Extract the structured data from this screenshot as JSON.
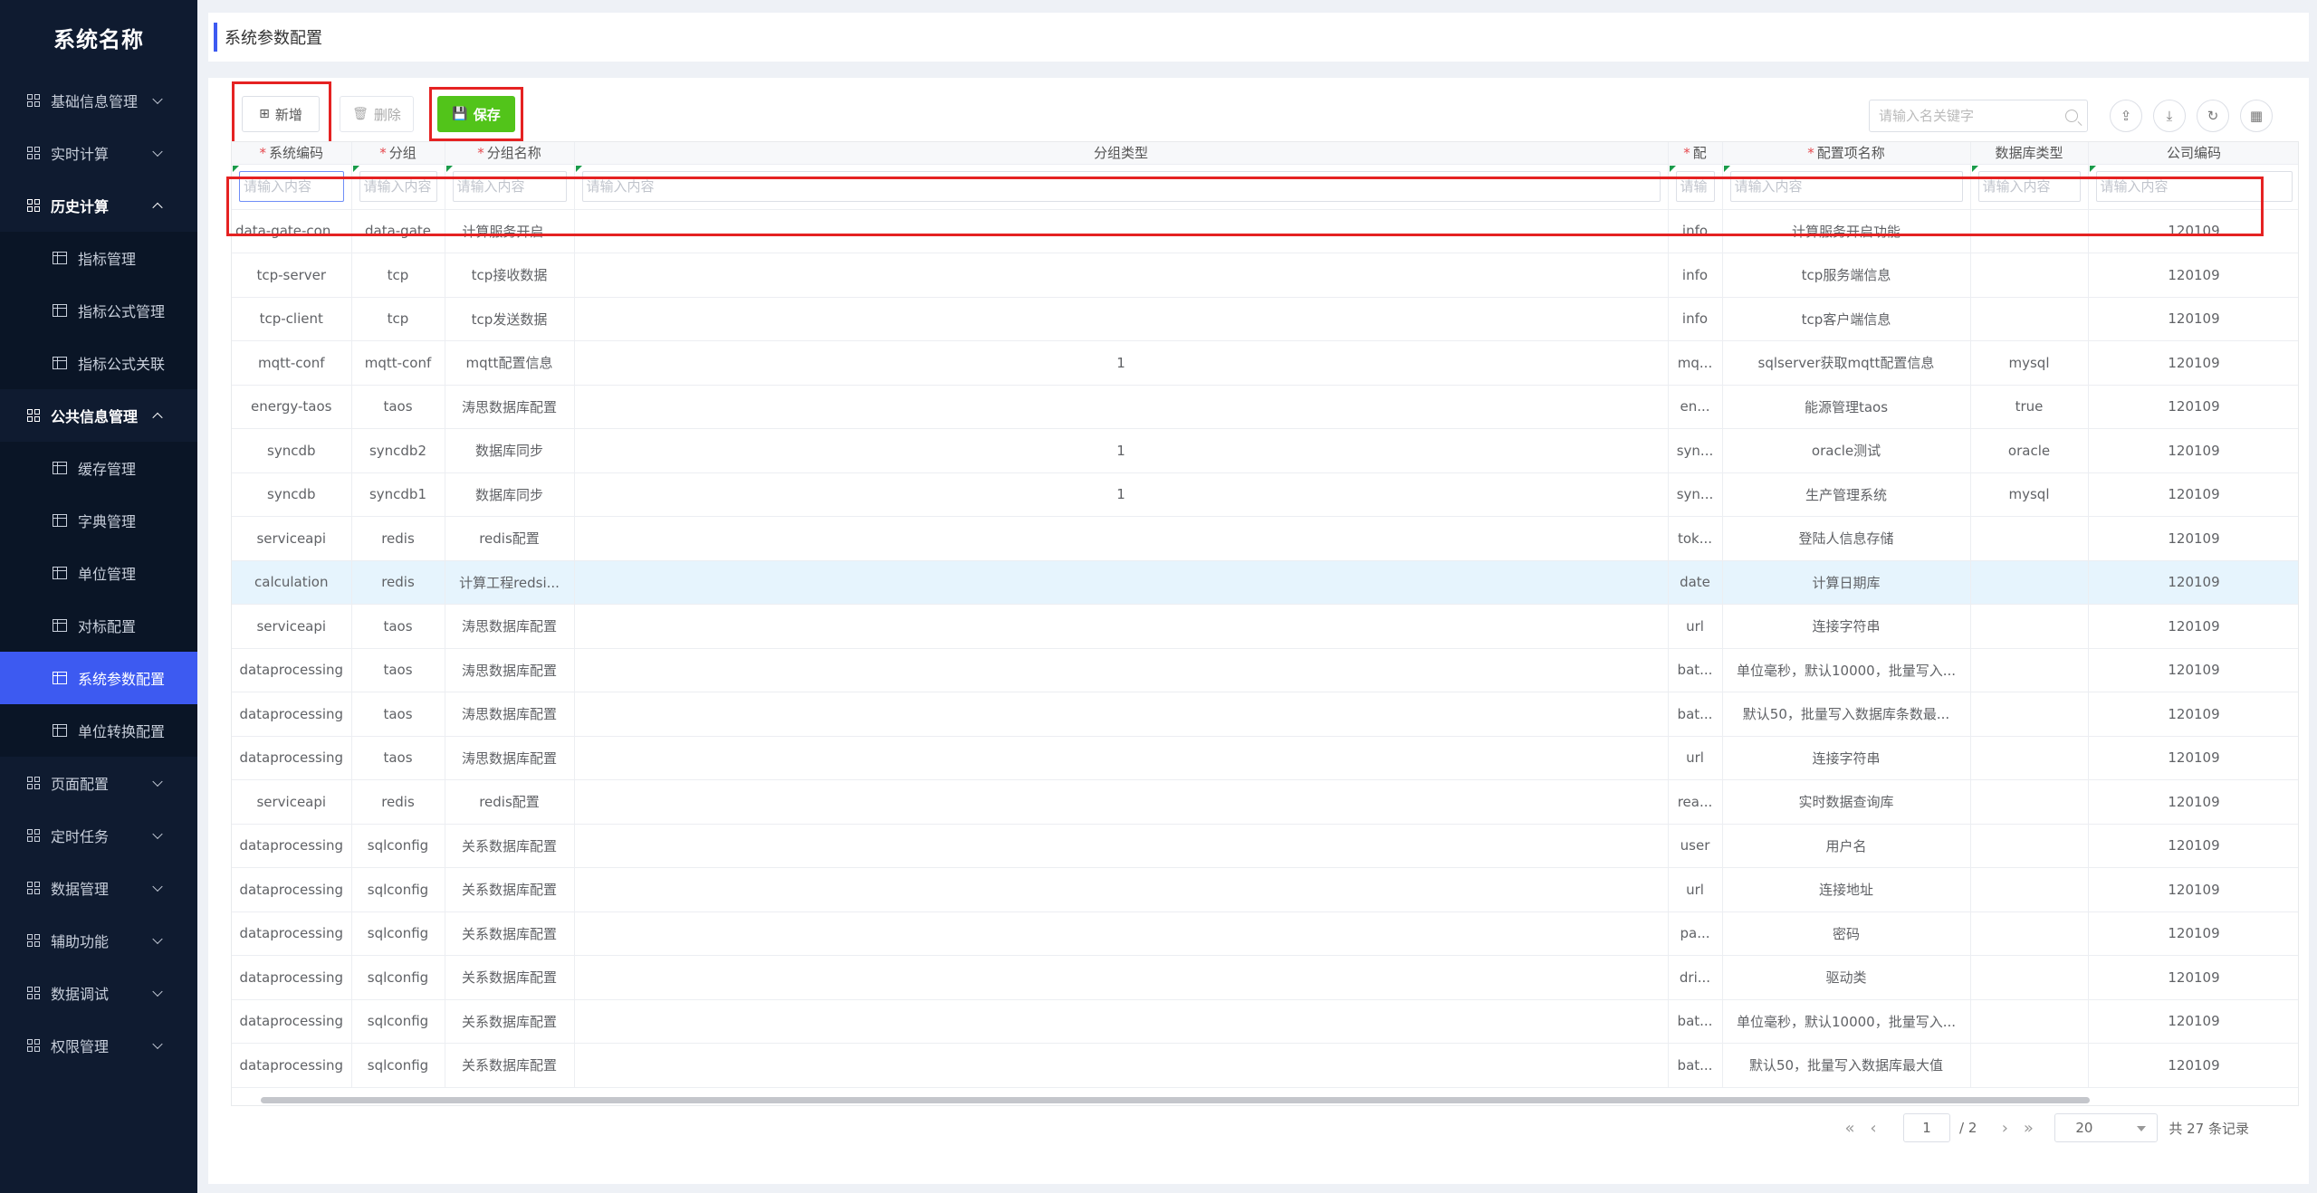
{
  "brand": "系统名称",
  "sidebar": {
    "items": [
      {
        "label": "基础信息管理"
      },
      {
        "label": "实时计算"
      },
      {
        "label": "历史计算",
        "children": [
          "指标管理",
          "指标公式管理",
          "指标公式关联"
        ]
      },
      {
        "label": "公共信息管理",
        "children": [
          "缓存管理",
          "字典管理",
          "单位管理",
          "对标配置",
          "系统参数配置",
          "单位转换配置"
        ]
      },
      {
        "label": "页面配置"
      },
      {
        "label": "定时任务"
      },
      {
        "label": "数据管理"
      },
      {
        "label": "辅助功能"
      },
      {
        "label": "数据调试"
      },
      {
        "label": "权限管理"
      }
    ],
    "active": "系统参数配置"
  },
  "page": {
    "title": "系统参数配置"
  },
  "toolbar": {
    "add_label": "新增",
    "delete_label": "删除",
    "save_label": "保存",
    "search_placeholder": "请输入名关键字"
  },
  "table": {
    "columns": [
      "系统编码",
      "分组",
      "分组名称",
      "分组类型",
      "配",
      "配置项名称",
      "数据库类型",
      "公司编码"
    ],
    "required": [
      true,
      true,
      true,
      false,
      true,
      true,
      false,
      false
    ],
    "filter_placeholder": "请输入内容",
    "filter_placeholder_short": "请输",
    "rows": [
      [
        "data-gate-config",
        "data-gate",
        "计算服务开启...",
        "",
        "info",
        "计算服务开启功能",
        "",
        "120109"
      ],
      [
        "tcp-server",
        "tcp",
        "tcp接收数据",
        "",
        "info",
        "tcp服务端信息",
        "",
        "120109"
      ],
      [
        "tcp-client",
        "tcp",
        "tcp发送数据",
        "",
        "info",
        "tcp客户端信息",
        "",
        "120109"
      ],
      [
        "mqtt-conf",
        "mqtt-conf",
        "mqtt配置信息",
        "1",
        "mq...",
        "sqlserver获取mqtt配置信息",
        "mysql",
        "120109"
      ],
      [
        "energy-taos",
        "taos",
        "涛思数据库配置",
        "",
        "en...",
        "能源管理taos",
        "true",
        "120109"
      ],
      [
        "syncdb",
        "syncdb2",
        "数据库同步",
        "1",
        "syn...",
        "oracle测试",
        "oracle",
        "120109"
      ],
      [
        "syncdb",
        "syncdb1",
        "数据库同步",
        "1",
        "syn...",
        "生产管理系统",
        "mysql",
        "120109"
      ],
      [
        "serviceapi",
        "redis",
        "redis配置",
        "",
        "tok...",
        "登陆人信息存储",
        "",
        "120109"
      ],
      [
        "calculation",
        "redis",
        "计算工程redsi...",
        "",
        "date",
        "计算日期库",
        "",
        "120109"
      ],
      [
        "serviceapi",
        "taos",
        "涛思数据库配置",
        "",
        "url",
        "连接字符串",
        "",
        "120109"
      ],
      [
        "dataprocessing",
        "taos",
        "涛思数据库配置",
        "",
        "bat...",
        "单位毫秒，默认10000，批量写入...",
        "",
        "120109"
      ],
      [
        "dataprocessing",
        "taos",
        "涛思数据库配置",
        "",
        "bat...",
        "默认50，批量写入数据库条数最...",
        "",
        "120109"
      ],
      [
        "dataprocessing",
        "taos",
        "涛思数据库配置",
        "",
        "url",
        "连接字符串",
        "",
        "120109"
      ],
      [
        "serviceapi",
        "redis",
        "redis配置",
        "",
        "rea...",
        "实时数据查询库",
        "",
        "120109"
      ],
      [
        "dataprocessing",
        "sqlconfig",
        "关系数据库配置",
        "",
        "user",
        "用户名",
        "",
        "120109"
      ],
      [
        "dataprocessing",
        "sqlconfig",
        "关系数据库配置",
        "",
        "url",
        "连接地址",
        "",
        "120109"
      ],
      [
        "dataprocessing",
        "sqlconfig",
        "关系数据库配置",
        "",
        "pa...",
        "密码",
        "",
        "120109"
      ],
      [
        "dataprocessing",
        "sqlconfig",
        "关系数据库配置",
        "",
        "dri...",
        "驱动类",
        "",
        "120109"
      ],
      [
        "dataprocessing",
        "sqlconfig",
        "关系数据库配置",
        "",
        "bat...",
        "单位毫秒，默认10000，批量写入...",
        "",
        "120109"
      ],
      [
        "dataprocessing",
        "sqlconfig",
        "关系数据库配置",
        "",
        "bat...",
        "默认50，批量写入数据库最大值",
        "",
        "120109"
      ]
    ],
    "selected_row": 8
  },
  "pagination": {
    "current": "1",
    "total_pages": "/ 2",
    "page_size": "20",
    "total_records": "共 27 条记录"
  },
  "colors": {
    "sidebar_bg": "#0f1b30",
    "active_bg": "#3d5af1",
    "save_green": "#52c41a",
    "highlight_red": "#e52222",
    "selected_row": "#e6f4fd"
  }
}
